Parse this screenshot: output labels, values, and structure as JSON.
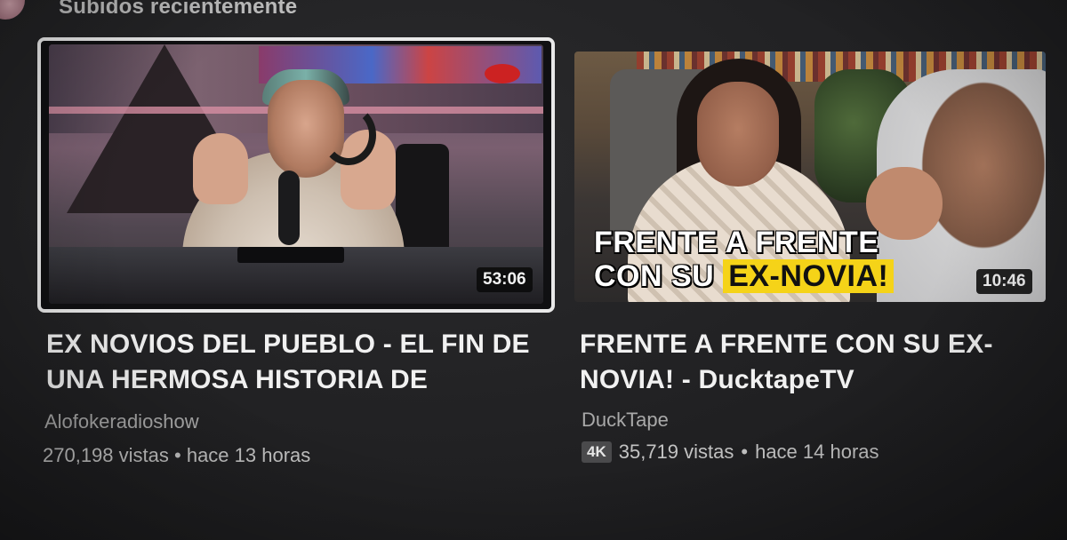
{
  "shelf": {
    "title": "Subidos recientemente"
  },
  "videos": [
    {
      "title": "EX NOVIOS DEL PUEBLO - EL FIN DE UNA HERMOSA HISTORIA DE",
      "channel": "Alofokeradioshow",
      "views": "270,198 vistas",
      "separator": "•",
      "age": "hace 13 horas",
      "duration": "53:06",
      "selected": true
    },
    {
      "title": "FRENTE A FRENTE CON SU EX-NOVIA! - DucktapeTV",
      "channel": "DuckTape",
      "badge": "4K",
      "views": "35,719 vistas",
      "separator": "•",
      "age": "hace 14 horas",
      "duration": "10:46",
      "thumbnail_text_line1": "FRENTE A FRENTE",
      "thumbnail_text_line2_prefix": "CON SU",
      "thumbnail_text_line2_highlight": "EX-NOVIA!",
      "selected": false
    }
  ],
  "colors": {
    "background": "#202022",
    "focus_border": "#e9e9e9",
    "highlight": "#f5d318",
    "title_text": "#f1f1f1",
    "secondary_text": "#a9a9a9"
  }
}
